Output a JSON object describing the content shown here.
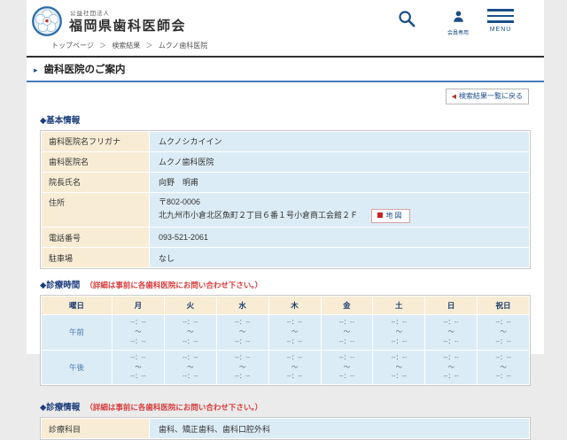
{
  "header": {
    "org_type": "公益社団法人",
    "org_name": "福岡県歯科医師会",
    "member_label": "会員専用",
    "menu_label": "MENU"
  },
  "breadcrumb": {
    "items": [
      "トップページ",
      "検索結果",
      "ムクノ歯科医院"
    ],
    "separator": "＞"
  },
  "page": {
    "title": "歯科医院のご案内",
    "title_arrow": "▸",
    "back_link": "検索結果一覧に戻る",
    "back_arrow": "◀"
  },
  "basic_info": {
    "heading": "◆基本情報",
    "rows": [
      {
        "label": "歯科医院名フリガナ",
        "value": "ムクノシカイイン"
      },
      {
        "label": "歯科医院名",
        "value": "ムクノ歯科医院"
      },
      {
        "label": "院長氏名",
        "value": "向野　明甫"
      },
      {
        "label": "住所",
        "postal": "〒802-0006",
        "address": "北九州市小倉北区魚町２丁目６番１号小倉商工会館２Ｆ",
        "map_label": "地図"
      },
      {
        "label": "電話番号",
        "value": "093-521-2061"
      },
      {
        "label": "駐車場",
        "value": "なし"
      }
    ]
  },
  "schedule": {
    "heading": "◆診療時間",
    "note": "（詳細は事前に各歯科医院にお問い合わせ下さい。）",
    "columns": [
      "曜日",
      "月",
      "火",
      "水",
      "木",
      "金",
      "土",
      "日",
      "祝日"
    ],
    "row_labels": [
      "午前",
      "午後"
    ],
    "time_lines": [
      "--：--",
      "～",
      "--：--"
    ]
  },
  "treatment_info": {
    "heading": "◆診療情報",
    "note": "（詳細は事前に各歯科医院にお問い合わせ下さい。）",
    "rows": [
      {
        "label": "診療科目",
        "value": "歯科、矯正歯科、歯科口腔外科"
      }
    ]
  }
}
